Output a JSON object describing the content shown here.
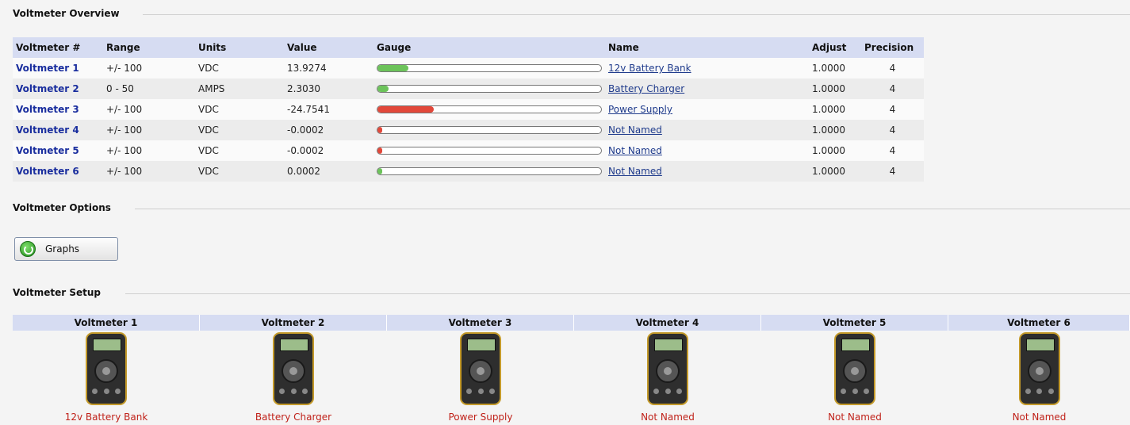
{
  "overview": {
    "title": "Voltmeter Overview",
    "headers": [
      "Voltmeter #",
      "Range",
      "Units",
      "Value",
      "Gauge",
      "Name",
      "Adjust",
      "Precision"
    ],
    "rows": [
      {
        "id": "Voltmeter 1",
        "range": "+/- 100",
        "units": "VDC",
        "value": "13.9274",
        "gauge_fraction": 0.14,
        "gauge_color": "#6cc35a",
        "name": "12v Battery Bank",
        "adjust": "1.0000",
        "precision": "4"
      },
      {
        "id": "Voltmeter 2",
        "range": "0 - 50",
        "units": "AMPS",
        "value": "2.3030",
        "gauge_fraction": 0.05,
        "gauge_color": "#6cc35a",
        "name": "Battery Charger",
        "adjust": "1.0000",
        "precision": "4"
      },
      {
        "id": "Voltmeter 3",
        "range": "+/- 100",
        "units": "VDC",
        "value": "-24.7541",
        "gauge_fraction": 0.25,
        "gauge_color": "#e2483a",
        "name": "Power Supply",
        "adjust": "1.0000",
        "precision": "4"
      },
      {
        "id": "Voltmeter 4",
        "range": "+/- 100",
        "units": "VDC",
        "value": "-0.0002",
        "gauge_fraction": 0.01,
        "gauge_color": "#e2483a",
        "name": "Not Named",
        "adjust": "1.0000",
        "precision": "4"
      },
      {
        "id": "Voltmeter 5",
        "range": "+/- 100",
        "units": "VDC",
        "value": "-0.0002",
        "gauge_fraction": 0.01,
        "gauge_color": "#e2483a",
        "name": "Not Named",
        "adjust": "1.0000",
        "precision": "4"
      },
      {
        "id": "Voltmeter 6",
        "range": "+/- 100",
        "units": "VDC",
        "value": "0.0002",
        "gauge_fraction": 0.01,
        "gauge_color": "#6cc35a",
        "name": "Not Named",
        "adjust": "1.0000",
        "precision": "4"
      }
    ]
  },
  "options": {
    "title": "Voltmeter Options",
    "graphs_label": "Graphs",
    "graphs_icon": "green-circle-refresh-icon"
  },
  "setup": {
    "title": "Voltmeter Setup",
    "meters": [
      {
        "label": "Voltmeter 1",
        "name": "12v Battery Bank"
      },
      {
        "label": "Voltmeter 2",
        "name": "Battery Charger"
      },
      {
        "label": "Voltmeter 3",
        "name": "Power Supply"
      },
      {
        "label": "Voltmeter 4",
        "name": "Not Named"
      },
      {
        "label": "Voltmeter 5",
        "name": "Not Named"
      },
      {
        "label": "Voltmeter 6",
        "name": "Not Named"
      }
    ],
    "meter_icon": "multimeter-icon"
  }
}
